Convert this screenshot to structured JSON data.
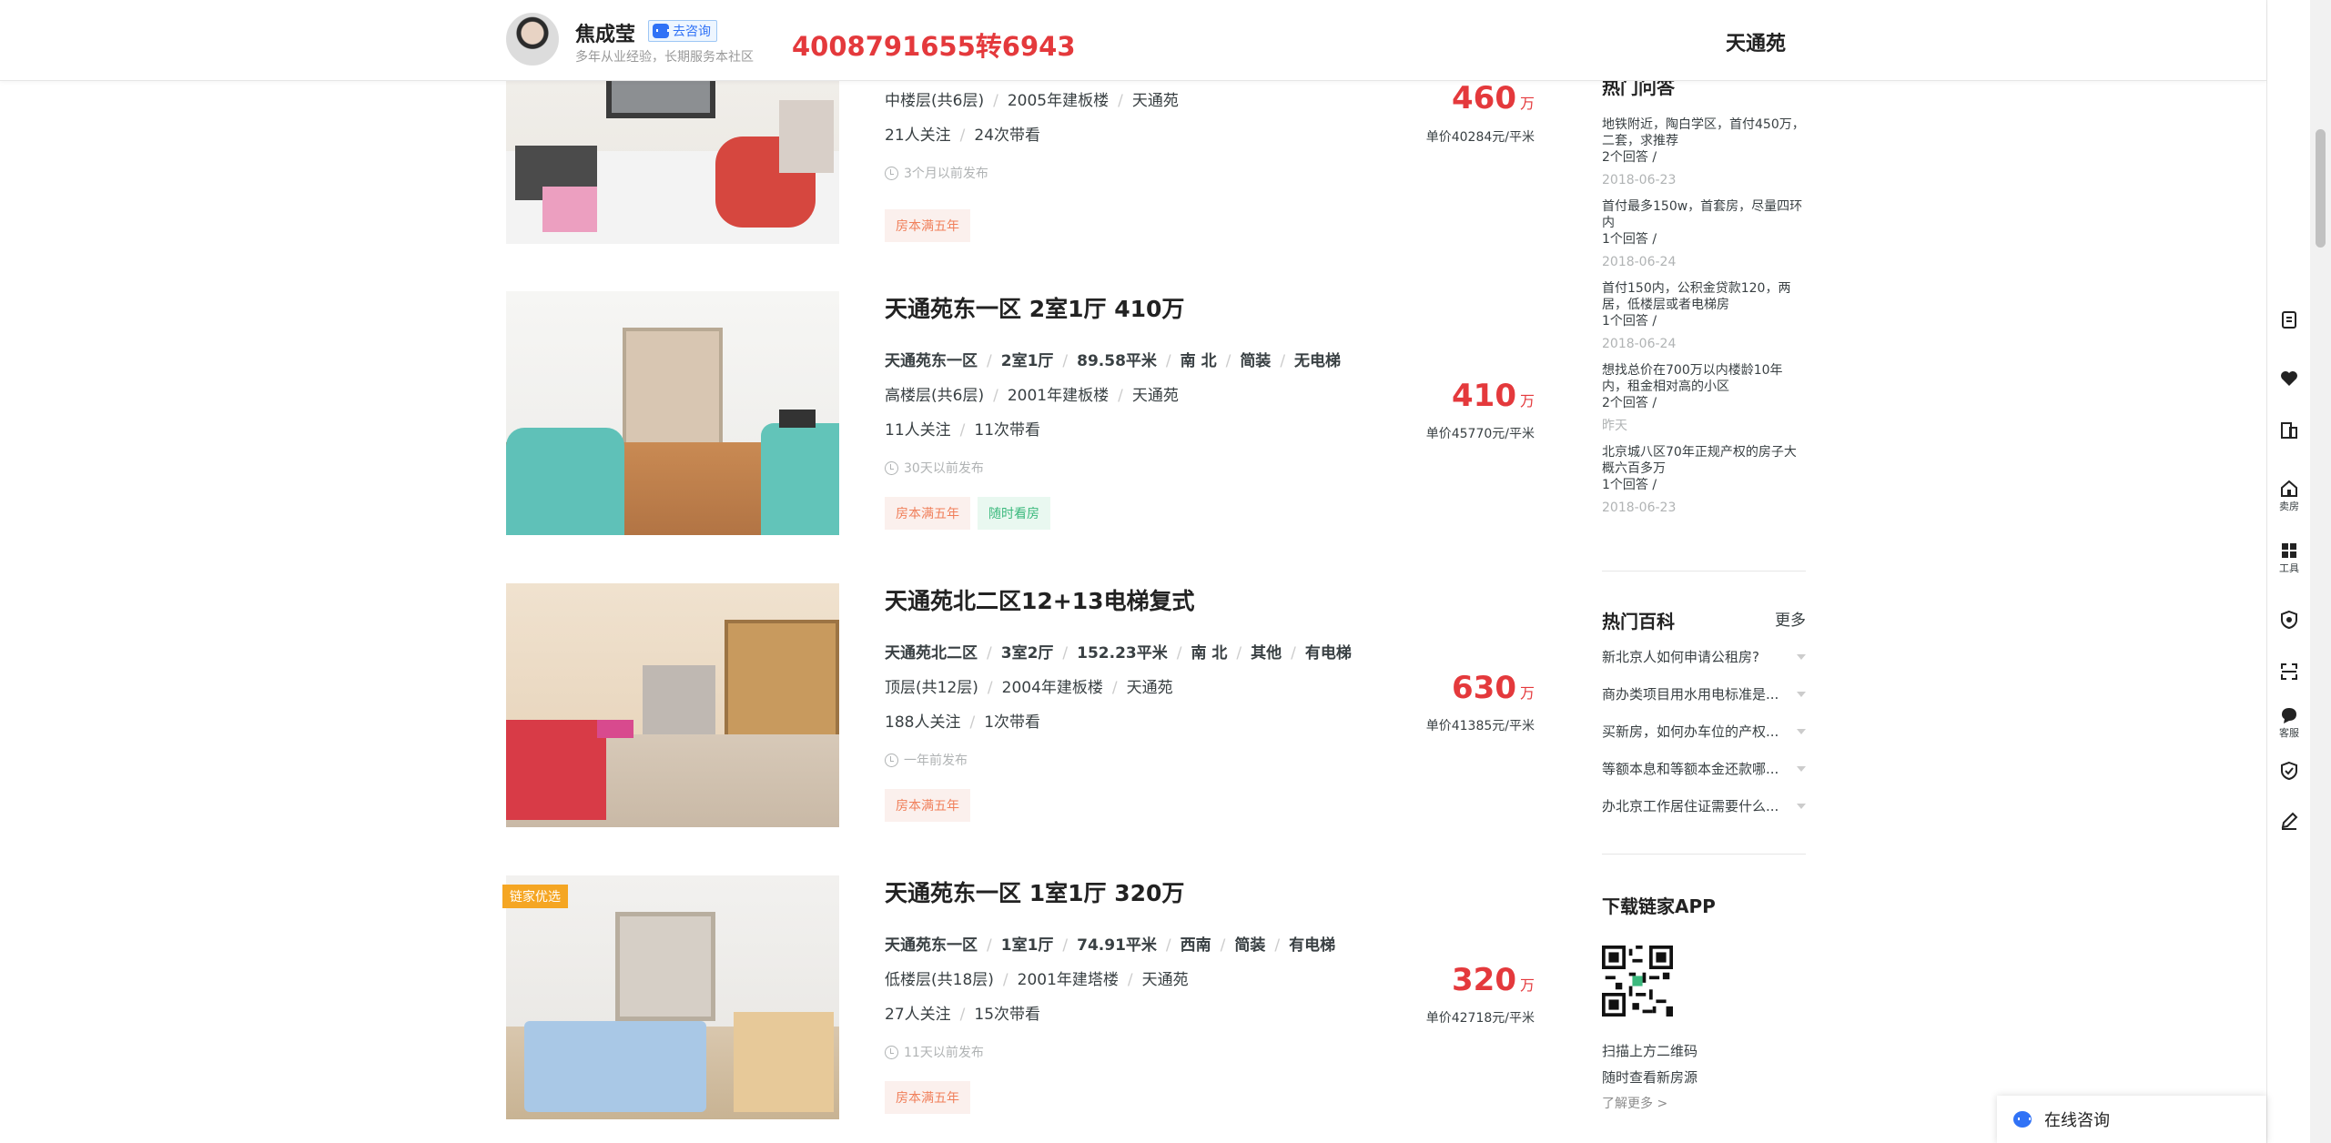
{
  "header": {
    "agent_name": "焦成莹",
    "consult_label": "去咨询",
    "agent_desc": "多年从业经验，长期服务本社区",
    "phone": "4008791655转6943",
    "community": "天通苑"
  },
  "listings": [
    {
      "title": "",
      "info1": [],
      "info2": [
        "中楼层(共6层)",
        "2005年建板楼",
        "天通苑"
      ],
      "info3": [
        "21人关注",
        "24次带看"
      ],
      "time": "3个月以前发布",
      "tags": [
        "房本满五年"
      ],
      "price": "460",
      "price_unit": "万",
      "unit_price": "单价40284元/平米"
    },
    {
      "title": "天通苑东一区 2室1厅 410万",
      "info1": [
        "天通苑东一区",
        "2室1厅",
        "89.58平米",
        "南 北",
        "简装",
        "无电梯"
      ],
      "info2": [
        "高楼层(共6层)",
        "2001年建板楼",
        "天通苑"
      ],
      "info3": [
        "11人关注",
        "11次带看"
      ],
      "time": "30天以前发布",
      "tags": [
        "房本满五年",
        "随时看房"
      ],
      "price": "410",
      "price_unit": "万",
      "unit_price": "单价45770元/平米"
    },
    {
      "title": "天通苑北二区12+13电梯复式",
      "info1": [
        "天通苑北二区",
        "3室2厅",
        "152.23平米",
        "南 北",
        "其他",
        "有电梯"
      ],
      "info2": [
        "顶层(共12层)",
        "2004年建板楼",
        "天通苑"
      ],
      "info3": [
        "188人关注",
        "1次带看"
      ],
      "time": "一年前发布",
      "tags": [
        "房本满五年"
      ],
      "price": "630",
      "price_unit": "万",
      "unit_price": "单价41385元/平米"
    },
    {
      "title": "天通苑东一区 1室1厅 320万",
      "badge": "链家优选",
      "info1": [
        "天通苑东一区",
        "1室1厅",
        "74.91平米",
        "西南",
        "简装",
        "有电梯"
      ],
      "info2": [
        "低楼层(共18层)",
        "2001年建塔楼",
        "天通苑"
      ],
      "info3": [
        "27人关注",
        "15次带看"
      ],
      "time": "11天以前发布",
      "tags": [
        "房本满五年"
      ],
      "price": "320",
      "price_unit": "万",
      "unit_price": "单价42718元/平米"
    }
  ],
  "sidebar": {
    "qa_title": "热门问答",
    "qa": [
      {
        "q": "地铁附近，陶白学区，首付450万，二套，求推荐",
        "a": "2个回答 /",
        "date": "2018-06-23"
      },
      {
        "q": "首付最多150w，首套房，尽量四环内",
        "a": "1个回答 /",
        "date": "2018-06-24"
      },
      {
        "q": "首付150内，公积金贷款120，两居，低楼层或者电梯房",
        "a": "1个回答 /",
        "date": "2018-06-24"
      },
      {
        "q": "想找总价在700万以内楼龄10年内，租金相对高的小区",
        "a": "2个回答 /",
        "date": "昨天"
      },
      {
        "q": "北京城八区70年正规产权的房子大概六百多万",
        "a": "1个回答 /",
        "date": "2018-06-23"
      }
    ],
    "wiki_title": "热门百科",
    "wiki_more": "更多",
    "wiki": [
      "新北京人如何申请公租房?",
      "商办类项目用水用电标准是...",
      "买新房，如何办车位的产权...",
      "等额本息和等额本金还款哪...",
      "办北京工作居住证需要什么..."
    ],
    "app_title": "下载链家APP",
    "app_lines": [
      "扫描上方二维码",
      "随时查看新房源"
    ],
    "app_more": "了解更多 >"
  },
  "toolbar": {
    "sell_label": "卖房",
    "tools_label": "工具",
    "service_label": "客服"
  },
  "chat": {
    "label": "在线咨询"
  },
  "colors": {
    "price": "#e4393c",
    "tag_red": "#f07f5a",
    "tag_green": "#3bb97d",
    "badge": "#f5a623",
    "consult": "#3072f6"
  }
}
